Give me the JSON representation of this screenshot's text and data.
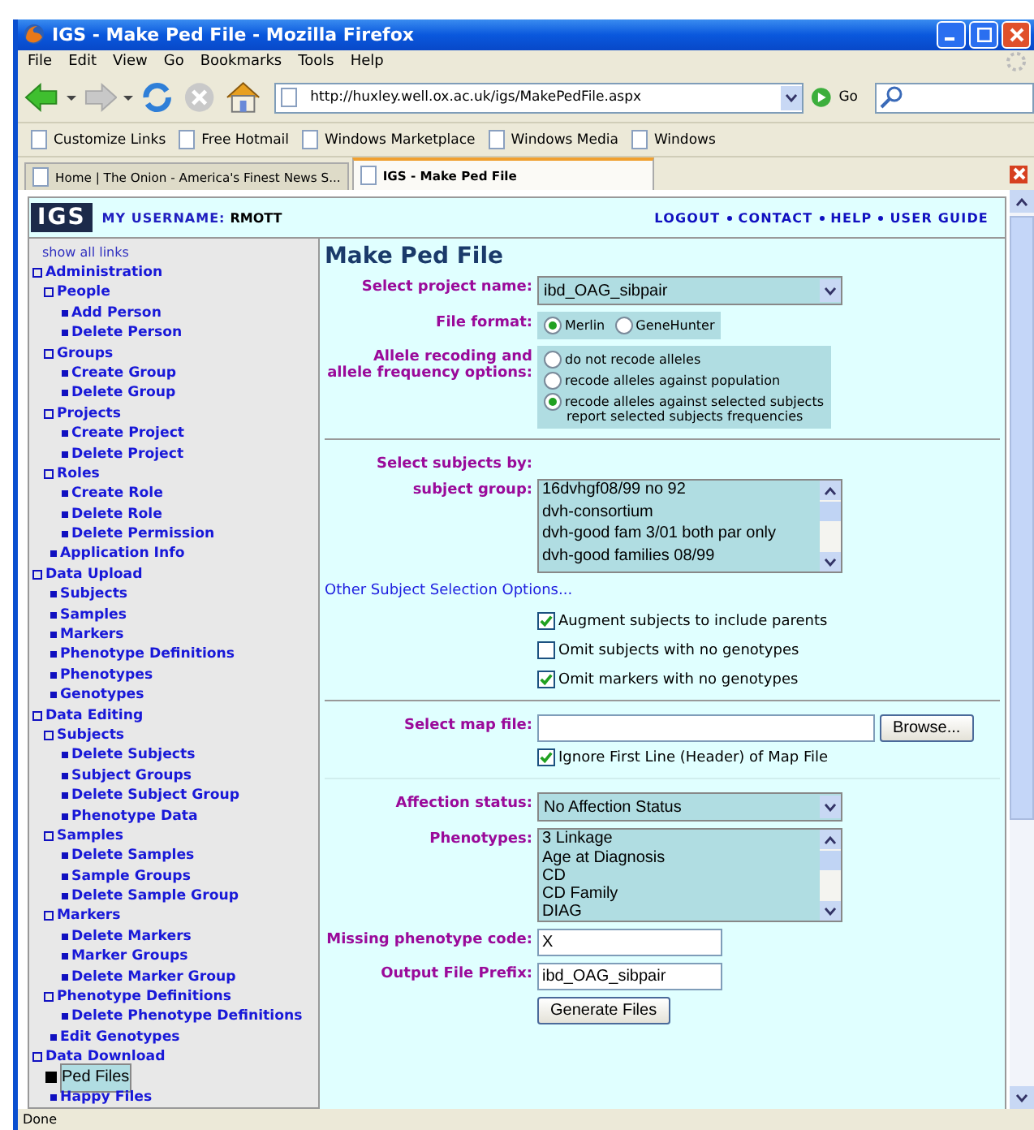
{
  "window": {
    "title": "IGS - Make Ped File - Mozilla Firefox"
  },
  "menu": [
    "File",
    "Edit",
    "View",
    "Go",
    "Bookmarks",
    "Tools",
    "Help"
  ],
  "address": {
    "value": "http://huxley.well.ox.ac.uk/igs/MakePedFile.aspx",
    "go": "Go"
  },
  "bookmarks": [
    "Customize Links",
    "Free Hotmail",
    "Windows Marketplace",
    "Windows Media",
    "Windows"
  ],
  "tabs": [
    {
      "label": "Home | The Onion - America's Finest News S...",
      "selected": false
    },
    {
      "label": "IGS - Make Ped File",
      "selected": true
    }
  ],
  "header": {
    "logo": "IGS",
    "username_label": "MY USERNAME:",
    "username": "RMOTT",
    "links": [
      "LOGOUT",
      "CONTACT",
      "HELP",
      "USER GUIDE"
    ]
  },
  "sidebar": {
    "show_all": "show all links",
    "items": [
      {
        "label": "Administration",
        "kind": "group",
        "selected": false,
        "children": [
          {
            "label": "People",
            "kind": "group",
            "selected": false,
            "children": [
              {
                "label": "Add Person",
                "kind": "leaf",
                "selected": false
              },
              {
                "label": "Delete Person",
                "kind": "leaf",
                "selected": false
              }
            ]
          },
          {
            "label": "Groups",
            "kind": "group",
            "selected": false,
            "children": [
              {
                "label": "Create Group",
                "kind": "leaf",
                "selected": false
              },
              {
                "label": "Delete Group",
                "kind": "leaf",
                "selected": false
              }
            ]
          },
          {
            "label": "Projects",
            "kind": "group",
            "selected": false,
            "children": [
              {
                "label": "Create Project",
                "kind": "leaf",
                "selected": false
              },
              {
                "label": "Delete Project",
                "kind": "leaf",
                "selected": false
              }
            ]
          },
          {
            "label": "Roles",
            "kind": "group",
            "selected": false,
            "children": [
              {
                "label": "Create Role",
                "kind": "leaf",
                "selected": false
              },
              {
                "label": "Delete Role",
                "kind": "leaf",
                "selected": false
              },
              {
                "label": "Delete Permission",
                "kind": "leaf",
                "selected": false
              }
            ]
          },
          {
            "label": "Application Info",
            "kind": "leaf",
            "selected": false
          }
        ]
      },
      {
        "label": "Data Upload",
        "kind": "group",
        "selected": false,
        "children": [
          {
            "label": "Subjects",
            "kind": "leaf",
            "selected": false
          },
          {
            "label": "Samples",
            "kind": "leaf",
            "selected": false
          },
          {
            "label": "Markers",
            "kind": "leaf",
            "selected": false
          },
          {
            "label": "Phenotype Definitions",
            "kind": "leaf",
            "selected": false
          },
          {
            "label": "Phenotypes",
            "kind": "leaf",
            "selected": false
          },
          {
            "label": "Genotypes",
            "kind": "leaf",
            "selected": false
          }
        ]
      },
      {
        "label": "Data Editing",
        "kind": "group",
        "selected": false,
        "children": [
          {
            "label": "Subjects",
            "kind": "group",
            "selected": false,
            "children": [
              {
                "label": "Delete Subjects",
                "kind": "leaf",
                "selected": false
              },
              {
                "label": "Subject Groups",
                "kind": "leaf",
                "selected": false
              },
              {
                "label": "Delete Subject Group",
                "kind": "leaf",
                "selected": false
              },
              {
                "label": "Phenotype Data",
                "kind": "leaf",
                "selected": false
              }
            ]
          },
          {
            "label": "Samples",
            "kind": "group",
            "selected": false,
            "children": [
              {
                "label": "Delete Samples",
                "kind": "leaf",
                "selected": false
              },
              {
                "label": "Sample Groups",
                "kind": "leaf",
                "selected": false
              },
              {
                "label": "Delete Sample Group",
                "kind": "leaf",
                "selected": false
              }
            ]
          },
          {
            "label": "Markers",
            "kind": "group",
            "selected": false,
            "children": [
              {
                "label": "Delete Markers",
                "kind": "leaf",
                "selected": false
              },
              {
                "label": "Marker Groups",
                "kind": "leaf",
                "selected": false
              },
              {
                "label": "Delete Marker Group",
                "kind": "leaf",
                "selected": false
              }
            ]
          },
          {
            "label": "Phenotype Definitions",
            "kind": "group",
            "selected": false,
            "children": [
              {
                "label": "Delete Phenotype Definitions",
                "kind": "leaf",
                "selected": false
              }
            ]
          },
          {
            "label": "Edit Genotypes",
            "kind": "leaf",
            "selected": false
          }
        ]
      },
      {
        "label": "Data Download",
        "kind": "group",
        "selected": false,
        "children": [
          {
            "label": "Ped Files",
            "kind": "leaf",
            "selected": true
          },
          {
            "label": "Happy Files",
            "kind": "leaf",
            "selected": false
          }
        ]
      }
    ]
  },
  "form": {
    "title": "Make Ped File",
    "project": {
      "label": "Select project name:",
      "value": "ibd_OAG_sibpair"
    },
    "file_format": {
      "label": "File format:",
      "options": [
        {
          "label": "Merlin",
          "selected": true
        },
        {
          "label": "GeneHunter",
          "selected": false
        }
      ]
    },
    "allele": {
      "label": "Allele recoding and allele frequency options:",
      "options": [
        {
          "label": "do not recode alleles",
          "selected": false
        },
        {
          "label": "recode alleles against population",
          "selected": false
        },
        {
          "label": "recode alleles against selected subjects",
          "note": "report selected subjects frequencies",
          "selected": true
        }
      ]
    },
    "subjects_by": {
      "label": "Select subjects by:"
    },
    "subject_group": {
      "label": "subject group:",
      "items": [
        "16dvhgf08/99 no 92",
        "dvh-consortium",
        "dvh-good fam 3/01 both par only",
        "dvh-good families 08/99"
      ]
    },
    "other_link": "Other Subject Selection Options...",
    "checks": [
      {
        "label": "Augment subjects to include parents",
        "checked": true
      },
      {
        "label": "Omit subjects with no genotypes",
        "checked": false
      },
      {
        "label": "Omit markers with no genotypes",
        "checked": true
      }
    ],
    "map_file": {
      "label": "Select map file:",
      "browse": "Browse...",
      "ignore": {
        "label": "Ignore First Line (Header) of Map File",
        "checked": true
      }
    },
    "affection": {
      "label": "Affection status:",
      "value": "No Affection Status"
    },
    "phenotypes": {
      "label": "Phenotypes:",
      "items": [
        "3 Linkage",
        "Age at Diagnosis",
        "CD",
        "CD Family",
        "DIAG"
      ]
    },
    "missing": {
      "label": "Missing phenotype code:",
      "value": "X"
    },
    "prefix": {
      "label": "Output File Prefix:",
      "value": "ibd_OAG_sibpair"
    },
    "generate": "Generate Files"
  },
  "status_bar": "Done"
}
